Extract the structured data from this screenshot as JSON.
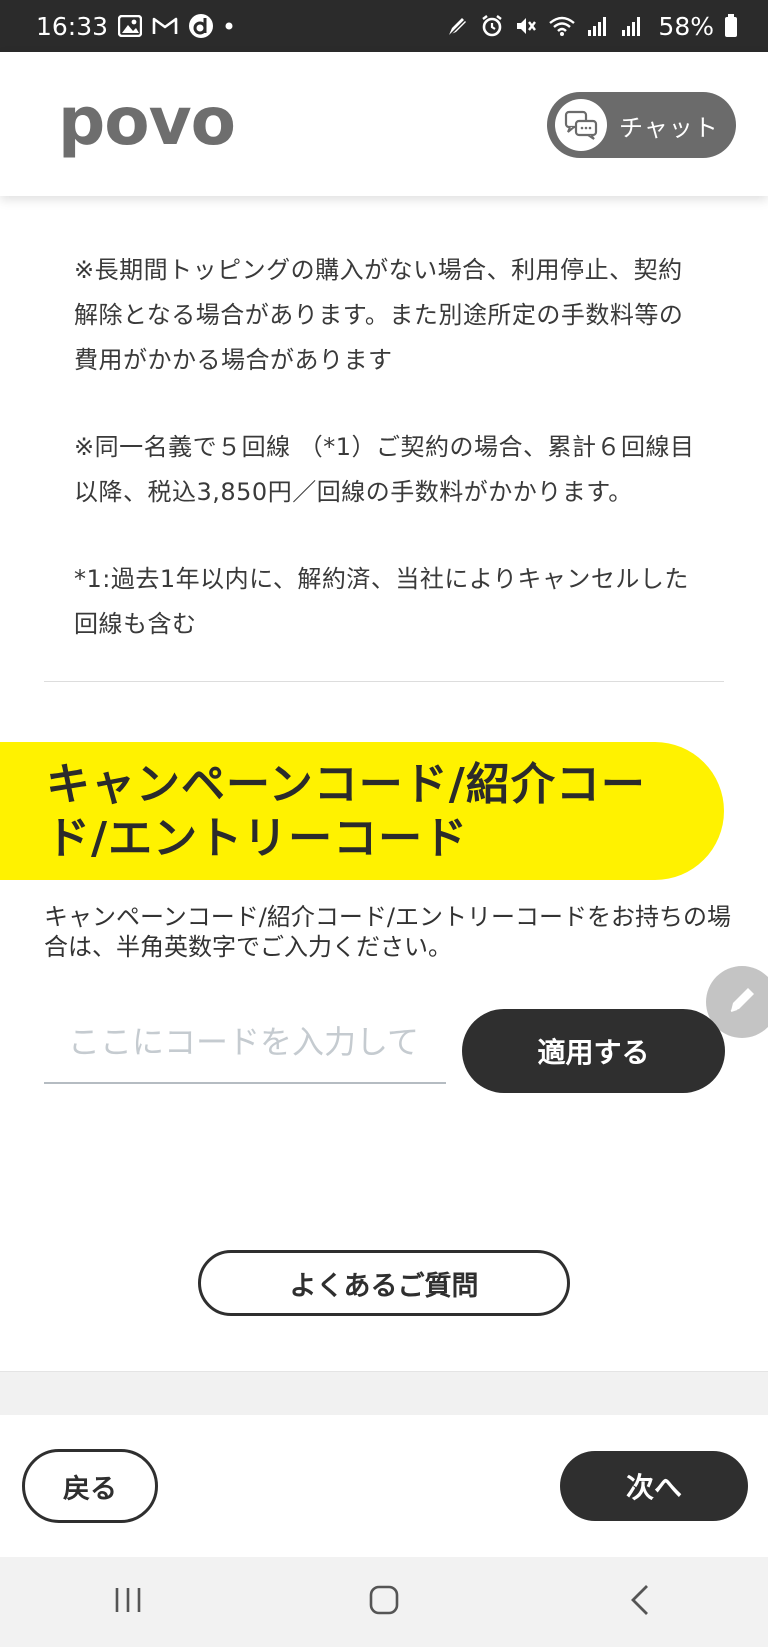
{
  "status_bar": {
    "time": "16:33",
    "battery": "58%",
    "icons_left": [
      "image-icon",
      "gmail-icon",
      "d-app-icon",
      "dot-icon"
    ],
    "icons_right": [
      "pen-icon",
      "alarm-icon",
      "mute-icon",
      "wifi-icon",
      "signal-icon",
      "signal-icon",
      "battery-icon"
    ]
  },
  "header": {
    "logo": "povo",
    "chat_label": "チャット"
  },
  "notes": [
    "※長期間トッピングの購入がない場合、利用停止、契約解除となる場合があります。また別途所定の手数料等の費用がかかる場合があります",
    "※同一名義で５回線 （*1）ご契約の場合、累計６回線目以降、税込3,850円／回線の手数料がかかります。",
    "*1:過去1年以内に、解約済、当社によりキャンセルした回線も含む"
  ],
  "campaign": {
    "title": "キャンペーンコード/紹介コード/エントリーコード",
    "description": "キャンペーンコード/紹介コード/エントリーコードをお持ちの場合は、半角英数字でご入力ください。",
    "input_placeholder": "ここにコードを入力してください",
    "apply_label": "適用する"
  },
  "faq_label": "よくあるご質問",
  "footer": {
    "back_label": "戻る",
    "next_label": "次へ"
  },
  "colors": {
    "accent_yellow": "#fff200",
    "dark_button": "#2f2f2f",
    "chat_gray": "#6b6b6b"
  }
}
